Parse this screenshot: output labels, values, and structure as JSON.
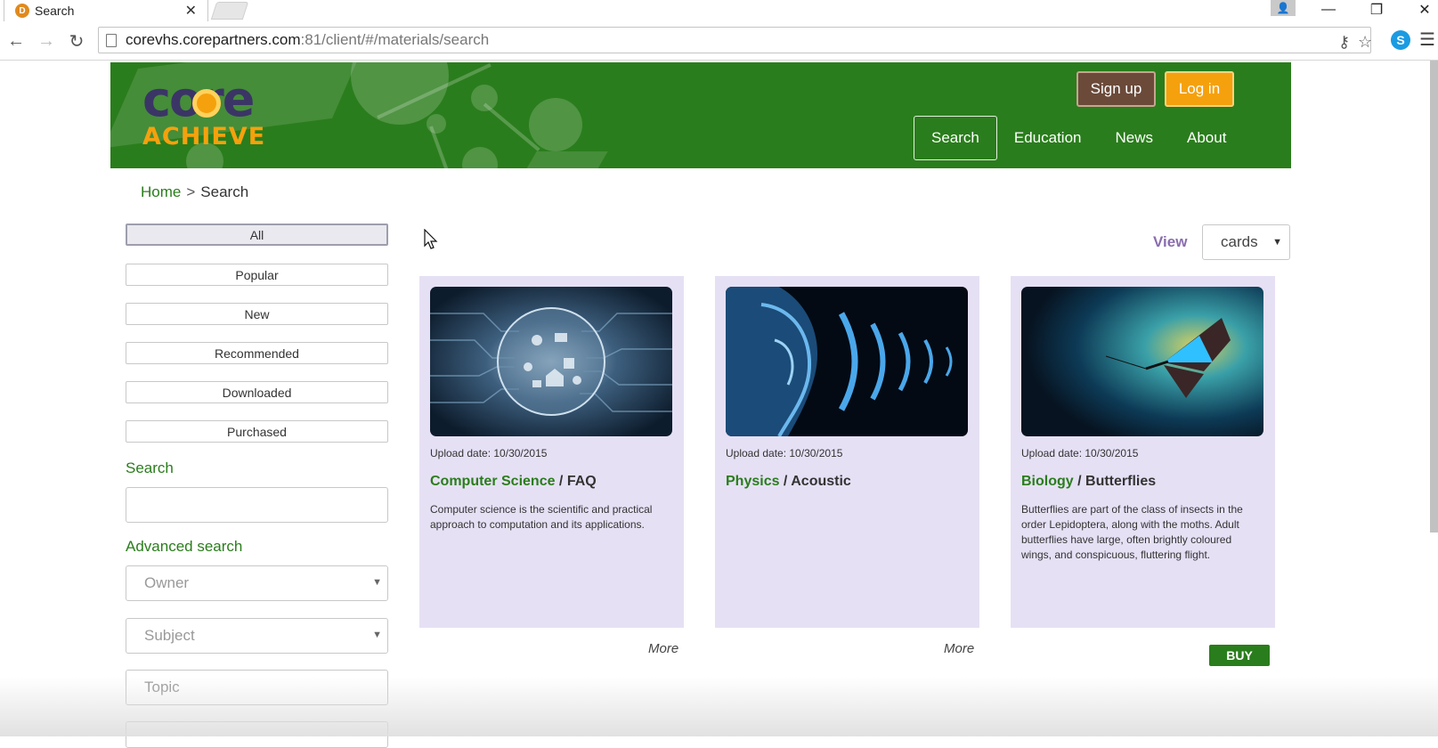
{
  "browser": {
    "tab_title": "Search",
    "tab_favicon_letter": "D",
    "url_host": "corevhs.corepartners.com",
    "url_path": ":81/client/#/materials/search"
  },
  "header": {
    "logo_top": "core",
    "logo_bottom": "ACHIEVE",
    "signup_label": "Sign up",
    "login_label": "Log in",
    "nav": [
      {
        "label": "Search"
      },
      {
        "label": "Education"
      },
      {
        "label": "News"
      },
      {
        "label": "About"
      }
    ],
    "colors": {
      "brand_green": "#2a7d1c",
      "accent_orange": "#f5a10d",
      "signup_brown": "#6b4a3a"
    }
  },
  "breadcrumb": {
    "home": "Home",
    "separator": ">",
    "current": "Search"
  },
  "sidebar": {
    "filters": [
      {
        "label": "All",
        "active": true
      },
      {
        "label": "Popular",
        "active": false
      },
      {
        "label": "New",
        "active": false
      },
      {
        "label": "Recommended",
        "active": false
      },
      {
        "label": "Downloaded",
        "active": false
      },
      {
        "label": "Purchased",
        "active": false
      }
    ],
    "search_heading": "Search",
    "search_value": "",
    "advanced_heading": "Advanced search",
    "owner_placeholder": "Owner",
    "subject_placeholder": "Subject",
    "topic_placeholder": "Topic"
  },
  "view": {
    "label": "View",
    "selected": "cards"
  },
  "cards": [
    {
      "date": "Upload date: 10/30/2015",
      "subject": "Computer Science",
      "separator": " / ",
      "topic": "FAQ",
      "description": "Computer science is the scientific and practical approach to computation and its applications.",
      "action": "More"
    },
    {
      "date": "Upload date: 10/30/2015",
      "subject": "Physics",
      "separator": " / ",
      "topic": "Acoustic",
      "description": "",
      "action": "More"
    },
    {
      "date": "Upload date: 10/30/2015",
      "subject": "Biology",
      "separator": " / ",
      "topic": "Butterflies",
      "description": "Butterflies are part of the class of insects in the order Lepidoptera, along with the moths. Adult butterflies have large, often brightly coloured wings, and conspicuous, fluttering flight.",
      "action": "BUY"
    }
  ]
}
